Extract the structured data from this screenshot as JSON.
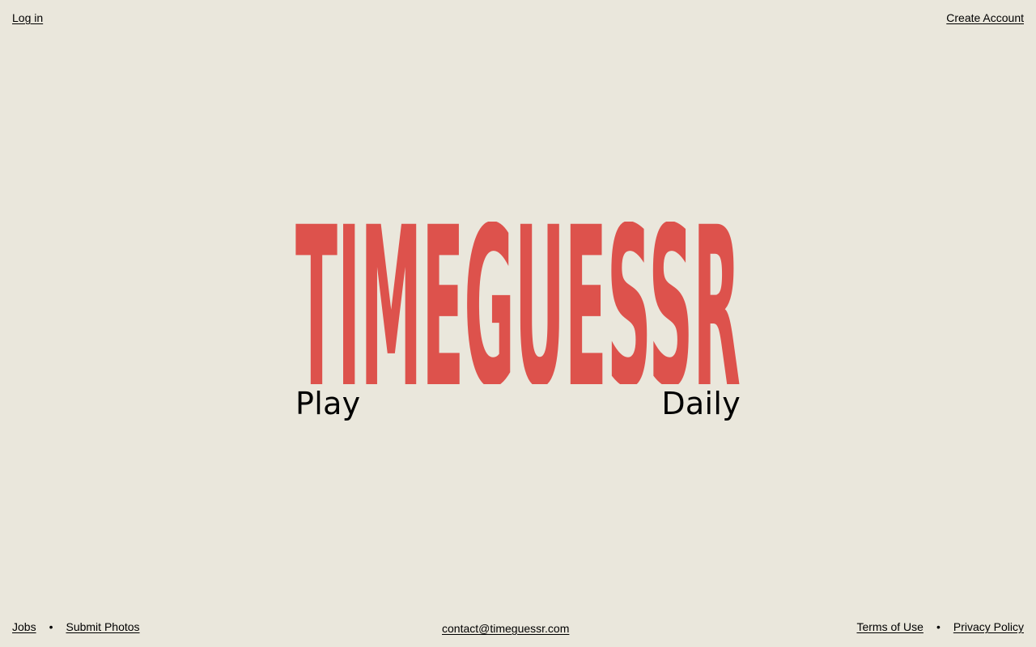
{
  "header": {
    "login_label": "Log in",
    "create_account_label": "Create Account"
  },
  "logo": {
    "text": "TIMEGUESSR",
    "color": "#DD524C"
  },
  "hero": {
    "play_label": "Play",
    "daily_label": "Daily"
  },
  "footer": {
    "jobs_label": "Jobs",
    "separator": "•",
    "submit_photos_label": "Submit Photos",
    "contact_email": "contact@timeguessr.com",
    "terms_label": "Terms of Use",
    "privacy_label": "Privacy Policy"
  },
  "colors": {
    "background": "#EAE7DC",
    "text": "#000000",
    "accent": "#DD524C"
  }
}
